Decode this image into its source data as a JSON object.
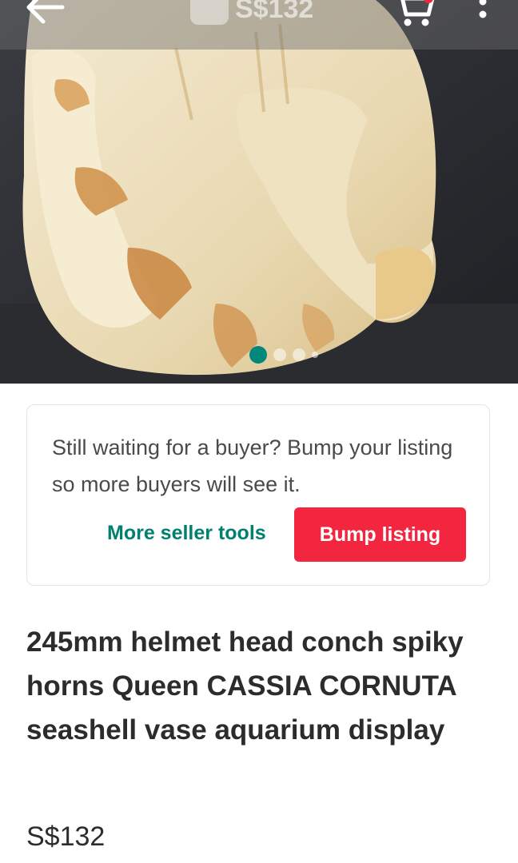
{
  "header": {
    "back_icon": "back-arrow-icon",
    "price": "S$132",
    "cart_icon": "cart-icon",
    "more_icon": "more-vertical-icon"
  },
  "gallery": {
    "image_description_for_alt": "",
    "image_count": 4,
    "active_index": 0
  },
  "bump_card": {
    "message": "Still waiting for a buyer? Bump your listing so more buyers will see it.",
    "tools_label": "More seller tools",
    "bump_label": "Bump listing"
  },
  "listing": {
    "title": "245mm helmet head conch spiky horns Queen CASSIA CORNUTA seashell vase aquarium display",
    "price": "S$132"
  },
  "colors": {
    "accent_green": "#00806e",
    "bump_red": "#f2263e",
    "text_dark": "#2c2c2c"
  }
}
